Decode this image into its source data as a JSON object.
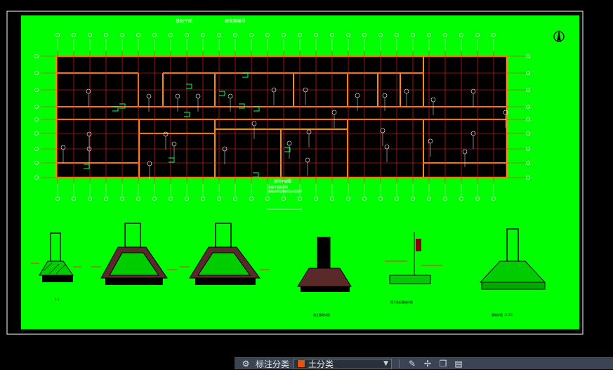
{
  "drawing": {
    "plan_title": "基础平面图",
    "plan_scale": "1:100",
    "plan_note_1": "基础平面图说明",
    "plan_note_2": "基础说明见结构设计总说明",
    "header_left": "基础平面",
    "header_right": "建筑物编号",
    "section_1_title": "1-1",
    "section_4_title": "独立基础详图",
    "section_5_title": "墙下条形基础详图",
    "section_6_title": "基础详图（1:25）",
    "colors": {
      "paper": "#00ff00",
      "wall": "#ff8c00",
      "axis": "#ff2020",
      "ink": "#ffffff",
      "room": "#000000",
      "accent": "#00ff66",
      "hatch_ink": "#7b1fa2"
    }
  },
  "statusbar": {
    "icons": [
      "annotation-scale-icon"
    ],
    "layer_label": "标注分类",
    "layer_value": "土分类",
    "layer_color": "#e0550f",
    "right_icons": [
      "pencil-icon",
      "move-icon",
      "copy-icon",
      "database-icon"
    ]
  }
}
